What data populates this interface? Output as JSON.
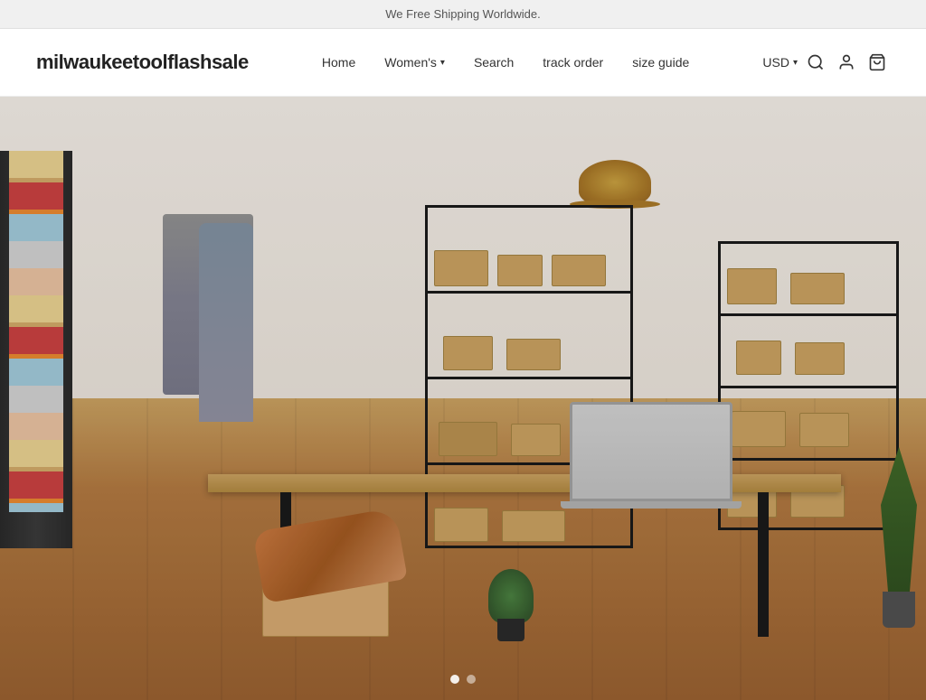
{
  "announcement": {
    "text": "We Free Shipping Worldwide."
  },
  "header": {
    "logo": "milwaukeetoolflashsale",
    "nav": {
      "home": "Home",
      "womens": "Women's",
      "search": "Search",
      "track_order": "track order",
      "size_guide": "size guide",
      "currency": "USD"
    },
    "icons": {
      "search": "🔍",
      "account": "👤",
      "cart": "🛒"
    }
  },
  "hero": {
    "slide_count": 2,
    "active_slide": 0
  },
  "slider": {
    "dots": [
      {
        "label": "Slide 1",
        "active": true
      },
      {
        "label": "Slide 2",
        "active": false
      }
    ]
  }
}
